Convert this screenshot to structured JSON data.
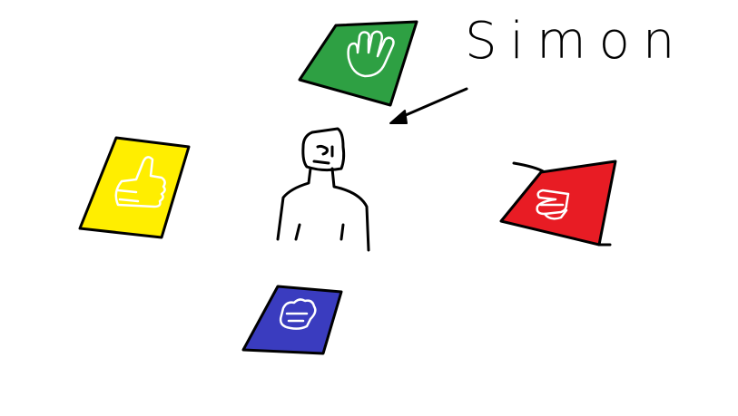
{
  "drawing": {
    "label": "Simon",
    "colors": {
      "green": "#2ea043",
      "yellow": "#ffee00",
      "red": "#e81c24",
      "blue": "#3a3cbf",
      "ink": "#000000",
      "background": "#ffffff"
    },
    "cards": [
      {
        "name": "green-card",
        "color": "green",
        "icon": "open-hand-icon"
      },
      {
        "name": "yellow-card",
        "color": "yellow",
        "icon": "thumbs-up-icon"
      },
      {
        "name": "red-card",
        "color": "red",
        "icon": "pointing-hand-icon"
      },
      {
        "name": "blue-card",
        "color": "blue",
        "icon": "fist-icon"
      }
    ]
  }
}
